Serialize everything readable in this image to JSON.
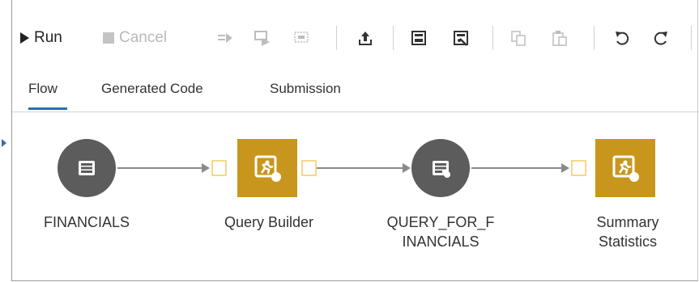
{
  "toolbar": {
    "run_label": "Run",
    "cancel_label": "Cancel"
  },
  "tabs": [
    {
      "label": "Flow",
      "active": true
    },
    {
      "label": "Generated Code",
      "active": false
    },
    {
      "label": "Submission",
      "active": false
    }
  ],
  "flow": {
    "nodes": [
      {
        "label": "FINANCIALS",
        "kind": "table",
        "icon": "table-icon"
      },
      {
        "label": "Query Builder",
        "kind": "step",
        "icon": "query-builder-icon"
      },
      {
        "label_line1": "QUERY_FOR_F",
        "label_line2": "INANCIALS",
        "kind": "table",
        "icon": "table-icon"
      },
      {
        "label_line1": "Summary",
        "label_line2": "Statistics",
        "kind": "step",
        "icon": "summary-statistics-icon"
      }
    ]
  },
  "colors": {
    "accent": "#2f6ea8",
    "step_node": "#c8961d",
    "table_node": "#5c5c5c",
    "port_border": "#f5d889",
    "edge": "#8a8a8a"
  }
}
